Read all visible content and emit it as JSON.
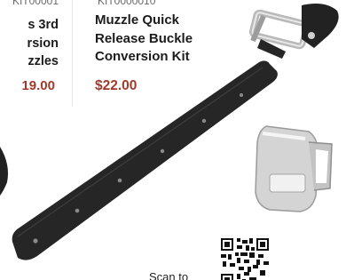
{
  "left_card": {
    "sku": "KIT00001",
    "title": "s 3rd\nrsion\nzzles",
    "price": "19.00"
  },
  "main_card": {
    "sku": "KIT0000010",
    "title": "Muzzle Quick Release Buckle Conversion Kit",
    "price": "$22.00"
  },
  "scan": {
    "text": "Scan to"
  },
  "colors": {
    "price": "#a23a2b",
    "title": "#1c1c1c",
    "strap": "#262626",
    "buckle": "#c9c9c9"
  },
  "icons": {
    "qr": "qr-code-icon"
  }
}
